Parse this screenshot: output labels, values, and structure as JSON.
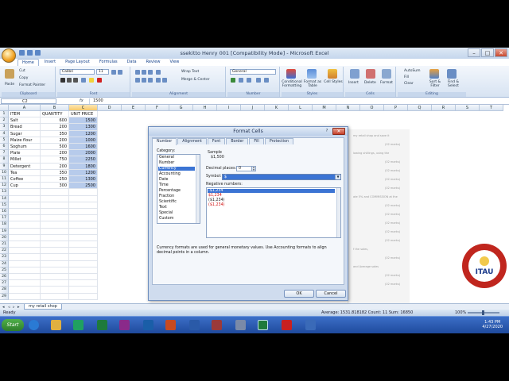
{
  "window": {
    "title": "ssekitto Henry 001  [Compatibility Mode] - Microsoft Excel",
    "minimize": "–",
    "maximize": "□",
    "close": "✕"
  },
  "tabs": [
    "Home",
    "Insert",
    "Page Layout",
    "Formulas",
    "Data",
    "Review",
    "View"
  ],
  "ribbon": {
    "clipboard": {
      "label": "Clipboard",
      "paste": "Paste",
      "cut": "Cut",
      "copy": "Copy",
      "format_painter": "Format Painter"
    },
    "font": {
      "label": "Font",
      "name": "Calibri",
      "size": "11"
    },
    "alignment": {
      "label": "Alignment",
      "wrap_text": "Wrap Text",
      "merge": "Merge & Center"
    },
    "number": {
      "label": "Number",
      "format": "General"
    },
    "styles": {
      "label": "Styles",
      "conditional": "Conditional Formatting",
      "format_table": "Format as Table",
      "cell_styles": "Cell Styles"
    },
    "cells": {
      "label": "Cells",
      "insert": "Insert",
      "delete": "Delete",
      "format": "Format"
    },
    "editing": {
      "label": "Editing",
      "autosum": "AutoSum",
      "fill": "Fill",
      "clear": "Clear",
      "sort": "Sort & Filter",
      "find": "Find & Select"
    }
  },
  "formula_bar": {
    "cell_ref": "C2",
    "fx": "fx",
    "value": "1500"
  },
  "grid": {
    "columns": [
      "A",
      "B",
      "C",
      "D",
      "E",
      "F",
      "G",
      "H",
      "I",
      "J",
      "K",
      "L",
      "M",
      "N",
      "O",
      "P",
      "Q",
      "R",
      "S",
      "T"
    ],
    "rows": [
      "1",
      "2",
      "3",
      "4",
      "5",
      "6",
      "7",
      "8",
      "9",
      "10",
      "11",
      "12",
      "13",
      "14",
      "15",
      "16",
      "17",
      "18",
      "19",
      "20",
      "21",
      "22",
      "23",
      "24",
      "25",
      "26",
      "27",
      "28",
      "29"
    ],
    "headers": [
      "ITEM",
      "QUANTITY",
      "UNIT PRICE"
    ],
    "data": [
      [
        "Salt",
        "600",
        "1500"
      ],
      [
        "Bread",
        "200",
        "1300"
      ],
      [
        "Sugar",
        "350",
        "1200"
      ],
      [
        "Maize flour",
        "200",
        "1000"
      ],
      [
        "Soghum",
        "500",
        "1600"
      ],
      [
        "Plate",
        "200",
        "2000"
      ],
      [
        "Millet",
        "750",
        "2250"
      ],
      [
        "Detergent",
        "200",
        "1800"
      ],
      [
        "Tea",
        "350",
        "1200"
      ],
      [
        "Coffee",
        "250",
        "1300"
      ],
      [
        "Cup",
        "300",
        "2500"
      ]
    ]
  },
  "sheet_tab": "my retail shop",
  "status": {
    "ready": "Ready",
    "stats": "Average: 1531.818182    Count: 11    Sum: 16850",
    "zoom": "100%"
  },
  "clock": {
    "time": "1:43 PM",
    "date": "4/27/2020"
  },
  "taskbar": {
    "start": "Start"
  },
  "dialog": {
    "title": "Format Cells",
    "help": "?",
    "close": "✕",
    "tabs": [
      "Number",
      "Alignment",
      "Font",
      "Border",
      "Fill",
      "Protection"
    ],
    "category_label": "Category:",
    "categories": [
      "General",
      "Number",
      "Currency",
      "Accounting",
      "Date",
      "Time",
      "Percentage",
      "Fraction",
      "Scientific",
      "Text",
      "Special",
      "Custom"
    ],
    "selected_category": 2,
    "sample_label": "Sample",
    "sample_value": "$1,500",
    "decimal_label": "Decimal places:",
    "decimal_value": "0",
    "symbol_label": "Symbol:",
    "symbol_value": "$",
    "negative_label": "Negative numbers:",
    "negative_options": [
      "-$1,234",
      "$1,234",
      "($1,234)",
      "($1,234)"
    ],
    "description": "Currency formats are used for general monetary values.  Use Accounting formats to align decimal points in a column.",
    "ok": "OK",
    "cancel": "Cancel"
  },
  "background_doc": {
    "lines": [
      "my retail shop and save it",
      "(02 marks)",
      "lowing shillings, using the",
      "(02 marks)",
      "(02 marks)",
      "(02 marks)",
      "(02 marks)",
      "ate 5% and COMMISSION at the",
      "(02 marks)",
      "(02 marks)",
      "(02 marks)",
      "(02 marks)",
      "(02 marks)",
      "f the sales,",
      "(02 marks)",
      "and Average sales",
      "(02 marks)",
      "(02 marks)"
    ]
  },
  "logo": {
    "text": "ITAU"
  },
  "colors": {
    "accent": "#3b74d4",
    "ribbon": "#d7e3f2",
    "taskbar": "#1f4a9c",
    "negative_red": "#d01010"
  }
}
